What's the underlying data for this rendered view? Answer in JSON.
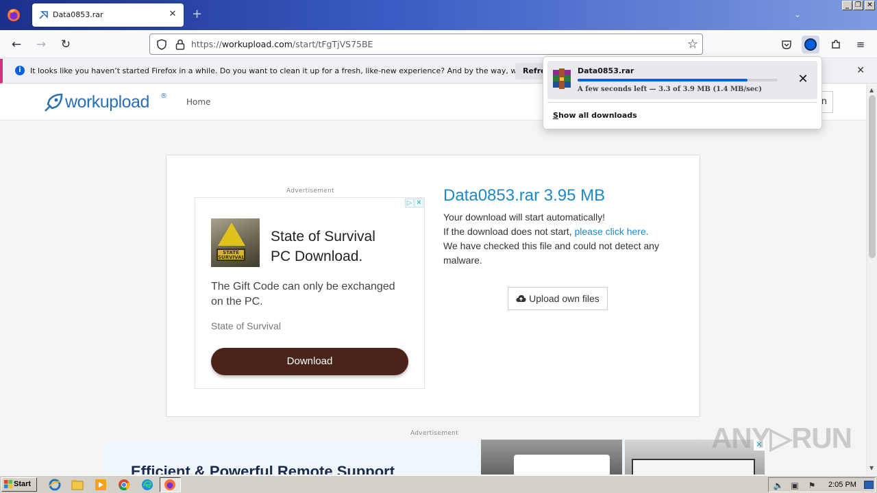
{
  "browser": {
    "tab_title": "Data0853.rar",
    "url_prefix": "https://",
    "url_domain": "workupload.com",
    "url_path": "/start/tFgTjVS75BE"
  },
  "notification": {
    "message": "It looks like you haven’t started Firefox in a while. Do you want to clean it up for a fresh, like-new experience? And by the way, welcome back!",
    "refresh_label": "Refresh"
  },
  "downloads": {
    "file_name": "Data0853.rar",
    "status": "A few seconds left — 3.3 of 3.9 MB (1.4 MB/sec)",
    "progress_fraction": 0.85,
    "show_all_prefix": "S",
    "show_all_rest": "how all downloads"
  },
  "site": {
    "logo_text": "workupload",
    "logo_mark": "®",
    "nav_home": "Home",
    "header_button": "n"
  },
  "ad1": {
    "label": "Advertisement",
    "headline_line1": "State of Survival",
    "headline_line2": "PC Download.",
    "body": "The Gift Code can only be exchanged on the PC.",
    "brand": "State of Survival",
    "cta": "Download",
    "image_text": "STATE SURVIVAL"
  },
  "file": {
    "title": "Data0853.rar 3.95 MB",
    "line1": "Your download will start automatically!",
    "line2_prefix": "If the download does not start, ",
    "line2_link": "please click here.",
    "line3": "We have checked this file and could not detect any malware.",
    "upload_button": "Upload own files"
  },
  "ad2": {
    "label": "Advertisement",
    "headline": "Efficient & Powerful Remote Support"
  },
  "watermark": "ANY▷RUN",
  "taskbar": {
    "start_label": "Start",
    "clock": "2:05 PM"
  },
  "colors": {
    "accent_blue": "#1e88c7",
    "download_progress": "#0060df",
    "ad_button": "#4a2418"
  }
}
